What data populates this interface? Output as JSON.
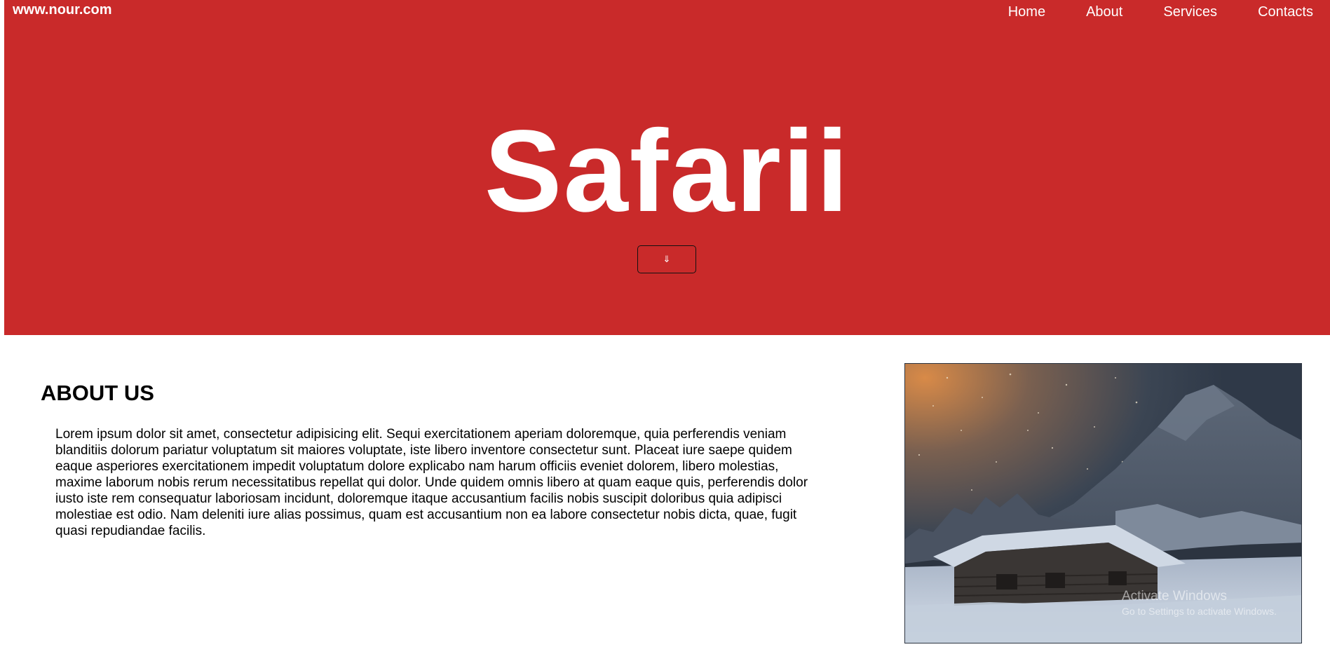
{
  "header": {
    "brand": "www.nour.com",
    "nav": [
      "Home",
      "About",
      "Services",
      "Contacts"
    ]
  },
  "hero": {
    "title": "Safarii",
    "scroll_button_icon": "down-arrow-icon",
    "scroll_button_glyph": "⇓",
    "background_color": "#c92a2a"
  },
  "about": {
    "heading": "ABOUT US",
    "text": "Lorem ipsum dolor sit amet, consectetur adipisicing elit. Sequi exercitationem aperiam doloremque, quia perferendis veniam blanditiis dolorum pariatur voluptatum sit maiores voluptate, iste libero inventore consectetur sunt. Placeat iure saepe quidem eaque asperiores exercitationem impedit voluptatum dolore explicabo nam harum officiis eveniet dolorem, libero molestias, maxime laborum nobis rerum necessitatibus repellat qui dolor. Unde quidem omnis libero at quam eaque quis, perferendis dolor iusto iste rem consequatur laboriosam incidunt, doloremque itaque accusantium facilis nobis suscipit doloribus quia adipisci molestiae est odio. Nam deleniti iure alias possimus, quam est accusantium non ea labore consectetur nobis dicta, quae, fugit quasi repudiandae facilis."
  },
  "watermark": {
    "line1": "Activate Windows",
    "line2": "Go to Settings to activate Windows."
  }
}
